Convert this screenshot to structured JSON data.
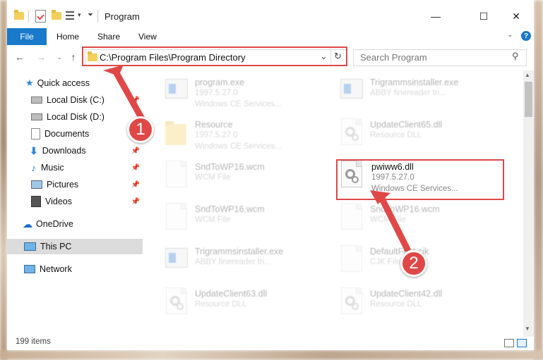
{
  "window": {
    "title": "Program",
    "controls": {
      "minimize": "—",
      "maximize": "☐",
      "close": "✕"
    }
  },
  "ribbon": {
    "tabs": [
      "File",
      "Home",
      "Share",
      "View"
    ],
    "help": "?"
  },
  "nav": {
    "address": "C:\\Program Files\\Program Directory",
    "search_placeholder": "Search Program"
  },
  "sidebar": {
    "items": [
      {
        "label": "Quick access",
        "icon": "star-icon",
        "pinned": false
      },
      {
        "label": "Local Disk (C:)",
        "icon": "drive-icon",
        "pinned": true
      },
      {
        "label": "Local Disk (D:)",
        "icon": "drive-icon",
        "pinned": false
      },
      {
        "label": "Documents",
        "icon": "documents-icon",
        "pinned": true
      },
      {
        "label": "Downloads",
        "icon": "download-icon",
        "pinned": true
      },
      {
        "label": "Music",
        "icon": "music-icon",
        "pinned": true
      },
      {
        "label": "Pictures",
        "icon": "pictures-icon",
        "pinned": true
      },
      {
        "label": "Videos",
        "icon": "videos-icon",
        "pinned": true
      },
      {
        "label": "OneDrive",
        "icon": "cloud-icon",
        "pinned": false
      },
      {
        "label": "This PC",
        "icon": "computer-icon",
        "pinned": false,
        "selected": true
      },
      {
        "label": "Network",
        "icon": "network-icon",
        "pinned": false
      }
    ]
  },
  "files": [
    {
      "name": "program.exe",
      "line2": "1997.5.27.0",
      "line3": "Windows CE Services...",
      "icon": "exe-icon"
    },
    {
      "name": "Trigrammsinstaller.exe",
      "line2": "ABBY finereader tri...",
      "line3": "",
      "icon": "exe-icon"
    },
    {
      "name": "Resource",
      "line2": "1997.5.27.0",
      "line3": "Windows CE Services...",
      "icon": "folder-icon"
    },
    {
      "name": "UpdateClient65.dll",
      "line2": "Resource DLL",
      "line3": "",
      "icon": "dll-icon"
    },
    {
      "name": "SndToWP16.wcm",
      "line2": "WCM File",
      "line3": "",
      "icon": "file-icon"
    },
    {
      "name": "pwiww6.dll",
      "line2": "1997.5.27.0",
      "line3": "Windows CE Services...",
      "icon": "dll-icon",
      "highlight": true
    },
    {
      "name": "SndToWP16.wcm",
      "line2": "WCM File",
      "line3": "",
      "icon": "file-icon"
    },
    {
      "name": "SndToWP16.wcm",
      "line2": "WCM File",
      "line3": "",
      "icon": "file-icon"
    },
    {
      "name": "Trigrammsinstaller.exe",
      "line2": "ABBY finereader tri...",
      "line3": "",
      "icon": "exe-icon"
    },
    {
      "name": "DefaultFont.cjk",
      "line2": "CJK File",
      "line3": "",
      "icon": "file-icon"
    },
    {
      "name": "UpdateClient63.dll",
      "line2": "Resource DLL",
      "line3": "",
      "icon": "dll-icon"
    },
    {
      "name": "UpdateClient42.dll",
      "line2": "Resource DLL",
      "line3": "",
      "icon": "dll-icon"
    }
  ],
  "status": {
    "count": "199 items"
  },
  "annotations": {
    "step1": "1",
    "step2": "2",
    "color": "#e04848"
  }
}
